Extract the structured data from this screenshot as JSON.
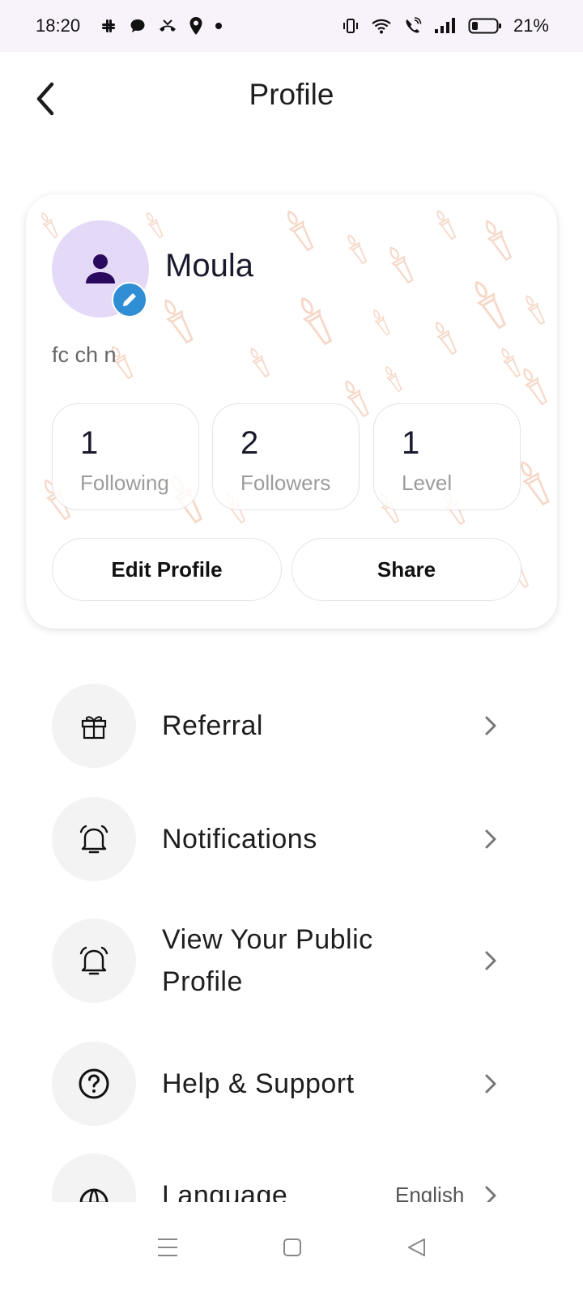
{
  "status_bar": {
    "time": "18:20",
    "battery": "21%",
    "notification_icons": [
      "slack-icon",
      "chat-bubble-icon",
      "missed-call-icon",
      "location-pin-icon",
      "dot-icon"
    ],
    "system_icons": [
      "vibrate-icon",
      "wifi-icon",
      "wifi-calling-icon",
      "signal-icon",
      "battery-icon"
    ]
  },
  "header": {
    "title": "Profile",
    "back_icon": "back-arrow-icon"
  },
  "profile_card": {
    "name": "Moula",
    "bio": "fc ch n",
    "avatar_icon": "person-icon",
    "edit_icon": "pencil-icon",
    "stats": [
      {
        "value": "1",
        "label": "Following"
      },
      {
        "value": "2",
        "label": "Followers"
      },
      {
        "value": "1",
        "label": "Level"
      }
    ],
    "buttons": {
      "edit": "Edit Profile",
      "share": "Share"
    }
  },
  "menu": [
    {
      "label": "Referral",
      "icon": "gift-icon"
    },
    {
      "label": "Notifications",
      "icon": "bell-icon"
    },
    {
      "label": "View Your Public Profile",
      "icon": "bell-icon"
    },
    {
      "label": "Help & Support",
      "icon": "question-circle-icon"
    },
    {
      "label": "Language",
      "icon": "globe-icon",
      "value": "English"
    }
  ],
  "nav_bar": {
    "icons": [
      "menu-icon",
      "home-square-icon",
      "back-triangle-icon"
    ]
  },
  "colors": {
    "accent_blue": "#2f8ed4",
    "avatar_bg": "#e5d9f8",
    "avatar_icon": "#2a0a5e",
    "status_bar_bg": "#f8f2fb",
    "pattern": "#f6d8c8"
  }
}
